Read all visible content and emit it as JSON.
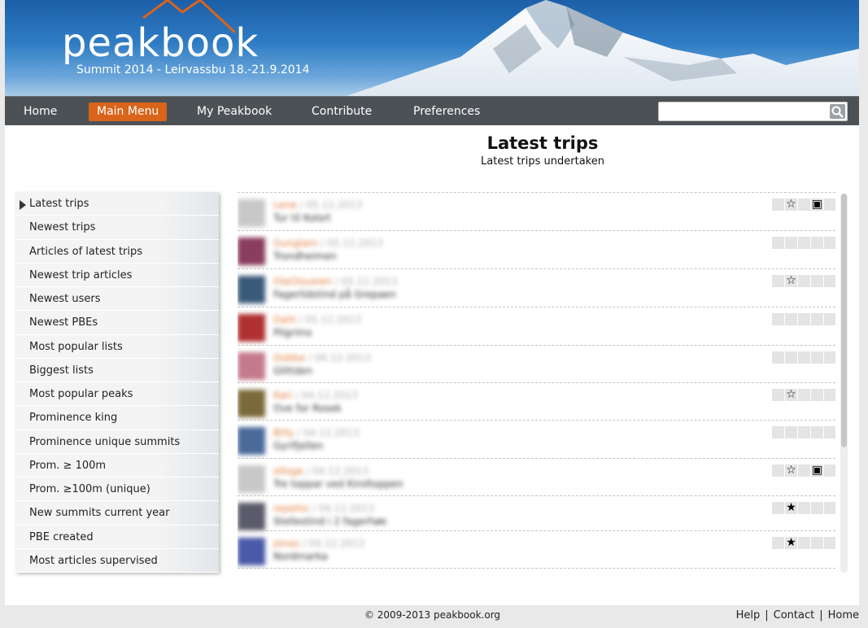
{
  "banner": {
    "logo": "peakbook",
    "subtitle": "Summit 2014 - Leirvassbu 18.-21.9.2014"
  },
  "nav": {
    "items": [
      {
        "label": "Home",
        "active": false
      },
      {
        "label": "Main Menu",
        "active": true
      },
      {
        "label": "My Peakbook",
        "active": false
      },
      {
        "label": "Contribute",
        "active": false
      },
      {
        "label": "Preferences",
        "active": false
      }
    ],
    "search_placeholder": "",
    "accent_color": "#d9641b"
  },
  "main": {
    "title": "Latest trips",
    "subtitle": "Latest trips undertaken"
  },
  "sidebar": {
    "items": [
      {
        "label": "Latest trips",
        "active": true
      },
      {
        "label": "Newest trips"
      },
      {
        "label": "Articles of latest trips"
      },
      {
        "label": "Newest trip articles"
      },
      {
        "label": "Newest users"
      },
      {
        "label": "Newest PBEs"
      },
      {
        "label": "Most popular lists"
      },
      {
        "label": "Biggest lists"
      },
      {
        "label": "Most popular peaks"
      },
      {
        "label": "Prominence king"
      },
      {
        "label": "Prominence unique summits"
      },
      {
        "label": "Prom. ≥ 100m"
      },
      {
        "label": "Prom. ≥100m (unique)"
      },
      {
        "label": "New summits current year"
      },
      {
        "label": "PBE created"
      },
      {
        "label": "Most articles supervised"
      }
    ]
  },
  "trips": {
    "rows": [
      {
        "user": "Lene",
        "date": "05.12.2013",
        "desc": "Tur til Kolsrt",
        "thumb_color": "#c8c8c8",
        "icons": [
          "",
          "☆",
          "",
          "▣",
          ""
        ]
      },
      {
        "user": "Gunglam",
        "date": "05.12.2013",
        "desc": "Trondheimen",
        "thumb_color": "#8a3d5e",
        "icons": [
          "",
          "",
          "",
          "",
          ""
        ]
      },
      {
        "user": "OlaOlsveien",
        "date": "05.12.2013",
        "desc": "Fagerlidstind på Grepaen",
        "thumb_color": "#3a5a7a",
        "icons": [
          "",
          "☆",
          "",
          "",
          ""
        ]
      },
      {
        "user": "Dahl",
        "date": "05.12.2013",
        "desc": "Pilgrims",
        "thumb_color": "#b03030",
        "icons": [
          "",
          "",
          "",
          "",
          ""
        ]
      },
      {
        "user": "Dobbe",
        "date": "06.12.2013",
        "desc": "Glittden",
        "thumb_color": "#c47a8a",
        "icons": [
          "",
          "",
          "",
          "",
          ""
        ]
      },
      {
        "user": "Kari",
        "date": "04.12.2013",
        "desc": "Ove for Rosek",
        "thumb_color": "#7a6a3a",
        "icons": [
          "",
          "☆",
          "",
          "",
          ""
        ]
      },
      {
        "user": "Billy",
        "date": "04.12.2013",
        "desc": "Gyrifjellen",
        "thumb_color": "#4a6a9a",
        "icons": [
          "",
          "",
          "",
          "",
          ""
        ]
      },
      {
        "user": "olloga",
        "date": "04.12.2013",
        "desc": "Tre toppar ved Kiroltoppen",
        "thumb_color": "#c8c8c8",
        "icons": [
          "",
          "☆",
          "",
          "▣",
          ""
        ]
      },
      {
        "user": "repetto",
        "date": "04.12.2013",
        "desc": "Stellestind i 2 fagerhøe",
        "thumb_color": "#5a5a6a",
        "icons": [
          "",
          "★",
          "",
          "",
          ""
        ]
      },
      {
        "user": "jonas",
        "date": "04.12.2013",
        "desc": "Nordmarka",
        "thumb_color": "#4a5aa8",
        "icons": [
          "",
          "★",
          "",
          "",
          ""
        ]
      }
    ]
  },
  "footer": {
    "copyright": "© 2009-2013 peakbook.org",
    "links": [
      "Help",
      "Contact",
      "Home"
    ]
  }
}
